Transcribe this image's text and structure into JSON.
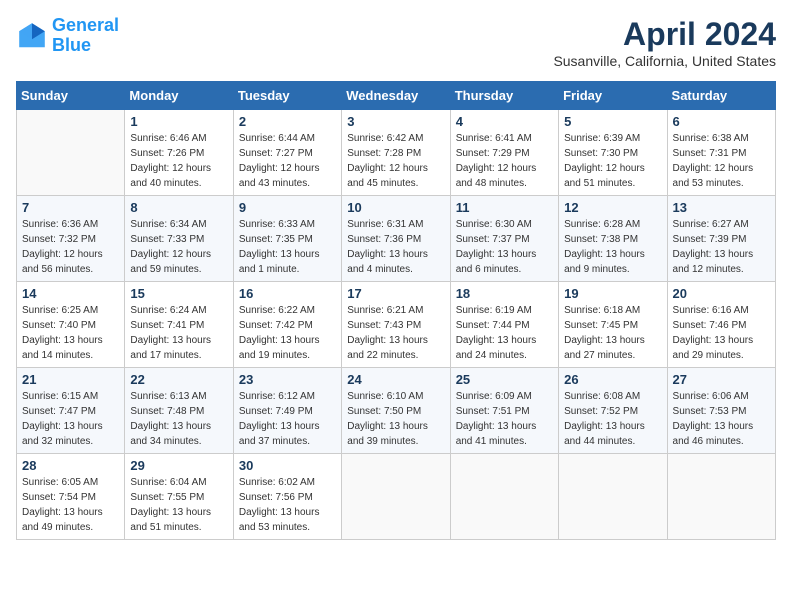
{
  "header": {
    "logo_line1": "General",
    "logo_line2": "Blue",
    "month_year": "April 2024",
    "location": "Susanville, California, United States"
  },
  "weekdays": [
    "Sunday",
    "Monday",
    "Tuesday",
    "Wednesday",
    "Thursday",
    "Friday",
    "Saturday"
  ],
  "weeks": [
    [
      {
        "day": "",
        "sunrise": "",
        "sunset": "",
        "daylight": ""
      },
      {
        "day": "1",
        "sunrise": "Sunrise: 6:46 AM",
        "sunset": "Sunset: 7:26 PM",
        "daylight": "Daylight: 12 hours and 40 minutes."
      },
      {
        "day": "2",
        "sunrise": "Sunrise: 6:44 AM",
        "sunset": "Sunset: 7:27 PM",
        "daylight": "Daylight: 12 hours and 43 minutes."
      },
      {
        "day": "3",
        "sunrise": "Sunrise: 6:42 AM",
        "sunset": "Sunset: 7:28 PM",
        "daylight": "Daylight: 12 hours and 45 minutes."
      },
      {
        "day": "4",
        "sunrise": "Sunrise: 6:41 AM",
        "sunset": "Sunset: 7:29 PM",
        "daylight": "Daylight: 12 hours and 48 minutes."
      },
      {
        "day": "5",
        "sunrise": "Sunrise: 6:39 AM",
        "sunset": "Sunset: 7:30 PM",
        "daylight": "Daylight: 12 hours and 51 minutes."
      },
      {
        "day": "6",
        "sunrise": "Sunrise: 6:38 AM",
        "sunset": "Sunset: 7:31 PM",
        "daylight": "Daylight: 12 hours and 53 minutes."
      }
    ],
    [
      {
        "day": "7",
        "sunrise": "Sunrise: 6:36 AM",
        "sunset": "Sunset: 7:32 PM",
        "daylight": "Daylight: 12 hours and 56 minutes."
      },
      {
        "day": "8",
        "sunrise": "Sunrise: 6:34 AM",
        "sunset": "Sunset: 7:33 PM",
        "daylight": "Daylight: 12 hours and 59 minutes."
      },
      {
        "day": "9",
        "sunrise": "Sunrise: 6:33 AM",
        "sunset": "Sunset: 7:35 PM",
        "daylight": "Daylight: 13 hours and 1 minute."
      },
      {
        "day": "10",
        "sunrise": "Sunrise: 6:31 AM",
        "sunset": "Sunset: 7:36 PM",
        "daylight": "Daylight: 13 hours and 4 minutes."
      },
      {
        "day": "11",
        "sunrise": "Sunrise: 6:30 AM",
        "sunset": "Sunset: 7:37 PM",
        "daylight": "Daylight: 13 hours and 6 minutes."
      },
      {
        "day": "12",
        "sunrise": "Sunrise: 6:28 AM",
        "sunset": "Sunset: 7:38 PM",
        "daylight": "Daylight: 13 hours and 9 minutes."
      },
      {
        "day": "13",
        "sunrise": "Sunrise: 6:27 AM",
        "sunset": "Sunset: 7:39 PM",
        "daylight": "Daylight: 13 hours and 12 minutes."
      }
    ],
    [
      {
        "day": "14",
        "sunrise": "Sunrise: 6:25 AM",
        "sunset": "Sunset: 7:40 PM",
        "daylight": "Daylight: 13 hours and 14 minutes."
      },
      {
        "day": "15",
        "sunrise": "Sunrise: 6:24 AM",
        "sunset": "Sunset: 7:41 PM",
        "daylight": "Daylight: 13 hours and 17 minutes."
      },
      {
        "day": "16",
        "sunrise": "Sunrise: 6:22 AM",
        "sunset": "Sunset: 7:42 PM",
        "daylight": "Daylight: 13 hours and 19 minutes."
      },
      {
        "day": "17",
        "sunrise": "Sunrise: 6:21 AM",
        "sunset": "Sunset: 7:43 PM",
        "daylight": "Daylight: 13 hours and 22 minutes."
      },
      {
        "day": "18",
        "sunrise": "Sunrise: 6:19 AM",
        "sunset": "Sunset: 7:44 PM",
        "daylight": "Daylight: 13 hours and 24 minutes."
      },
      {
        "day": "19",
        "sunrise": "Sunrise: 6:18 AM",
        "sunset": "Sunset: 7:45 PM",
        "daylight": "Daylight: 13 hours and 27 minutes."
      },
      {
        "day": "20",
        "sunrise": "Sunrise: 6:16 AM",
        "sunset": "Sunset: 7:46 PM",
        "daylight": "Daylight: 13 hours and 29 minutes."
      }
    ],
    [
      {
        "day": "21",
        "sunrise": "Sunrise: 6:15 AM",
        "sunset": "Sunset: 7:47 PM",
        "daylight": "Daylight: 13 hours and 32 minutes."
      },
      {
        "day": "22",
        "sunrise": "Sunrise: 6:13 AM",
        "sunset": "Sunset: 7:48 PM",
        "daylight": "Daylight: 13 hours and 34 minutes."
      },
      {
        "day": "23",
        "sunrise": "Sunrise: 6:12 AM",
        "sunset": "Sunset: 7:49 PM",
        "daylight": "Daylight: 13 hours and 37 minutes."
      },
      {
        "day": "24",
        "sunrise": "Sunrise: 6:10 AM",
        "sunset": "Sunset: 7:50 PM",
        "daylight": "Daylight: 13 hours and 39 minutes."
      },
      {
        "day": "25",
        "sunrise": "Sunrise: 6:09 AM",
        "sunset": "Sunset: 7:51 PM",
        "daylight": "Daylight: 13 hours and 41 minutes."
      },
      {
        "day": "26",
        "sunrise": "Sunrise: 6:08 AM",
        "sunset": "Sunset: 7:52 PM",
        "daylight": "Daylight: 13 hours and 44 minutes."
      },
      {
        "day": "27",
        "sunrise": "Sunrise: 6:06 AM",
        "sunset": "Sunset: 7:53 PM",
        "daylight": "Daylight: 13 hours and 46 minutes."
      }
    ],
    [
      {
        "day": "28",
        "sunrise": "Sunrise: 6:05 AM",
        "sunset": "Sunset: 7:54 PM",
        "daylight": "Daylight: 13 hours and 49 minutes."
      },
      {
        "day": "29",
        "sunrise": "Sunrise: 6:04 AM",
        "sunset": "Sunset: 7:55 PM",
        "daylight": "Daylight: 13 hours and 51 minutes."
      },
      {
        "day": "30",
        "sunrise": "Sunrise: 6:02 AM",
        "sunset": "Sunset: 7:56 PM",
        "daylight": "Daylight: 13 hours and 53 minutes."
      },
      {
        "day": "",
        "sunrise": "",
        "sunset": "",
        "daylight": ""
      },
      {
        "day": "",
        "sunrise": "",
        "sunset": "",
        "daylight": ""
      },
      {
        "day": "",
        "sunrise": "",
        "sunset": "",
        "daylight": ""
      },
      {
        "day": "",
        "sunrise": "",
        "sunset": "",
        "daylight": ""
      }
    ]
  ]
}
